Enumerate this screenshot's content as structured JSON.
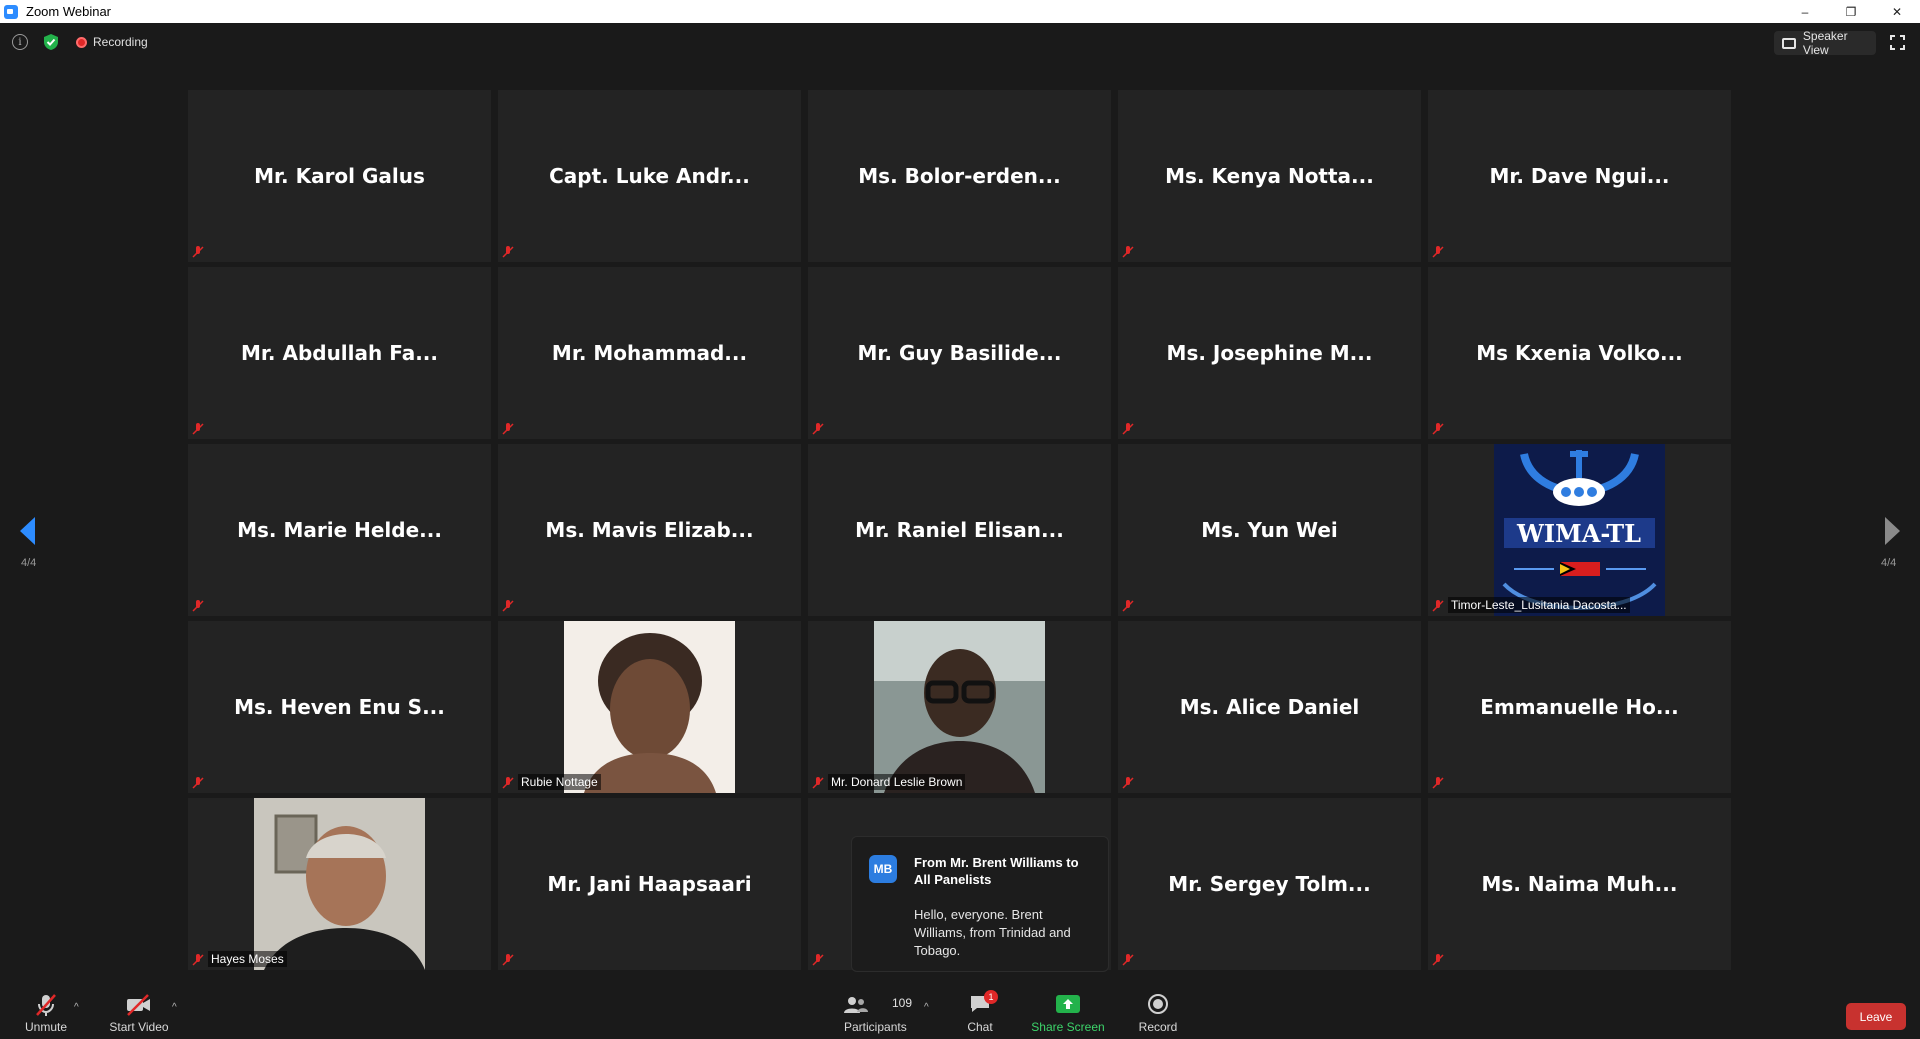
{
  "window": {
    "title": "Zoom Webinar",
    "controls": [
      "–",
      "❐",
      "✕"
    ]
  },
  "topbar": {
    "recording_label": "Recording",
    "speaker_view_label": "Speaker View"
  },
  "grid": {
    "page_indicator": "4/4",
    "tiles": [
      {
        "name": "Mr. Karol Galus"
      },
      {
        "name": "Capt. Luke Andr..."
      },
      {
        "name": "Ms.  Bolor-erden..."
      },
      {
        "name": "Ms. Kenya Notta..."
      },
      {
        "name": "Mr. Dave Ngui..."
      },
      {
        "name": "Mr. Abdullah Fa..."
      },
      {
        "name": "Mr.  Mohammad..."
      },
      {
        "name": "Mr. Guy Basilide..."
      },
      {
        "name": "Ms. Josephine M..."
      },
      {
        "name": "Ms Kxenia Volko..."
      },
      {
        "name": "Ms. Marie Helde..."
      },
      {
        "name": "Ms. Mavis Elizab..."
      },
      {
        "name": "Mr. Raniel Elisan..."
      },
      {
        "name": "Ms. Yun Wei"
      },
      {
        "label": "Timor-Leste_Lusitania Dacosta...",
        "image": "wima-tl-logo",
        "logo_text": "WIMA-TL"
      },
      {
        "name": "Ms. Heven Enu S..."
      },
      {
        "label": "Rubie Nottage",
        "image": "person-photo"
      },
      {
        "label": "Mr. Donard Leslie Brown",
        "image": "person-photo"
      },
      {
        "name": "Ms. Alice Daniel"
      },
      {
        "name": "Emmanuelle  Ho..."
      },
      {
        "label": "Hayes Moses",
        "image": "person-photo"
      },
      {
        "name": "Mr. Jani Haapsaari"
      },
      {
        "name": ""
      },
      {
        "name": "Mr. Sergey Tolm..."
      },
      {
        "name": "Ms. Naima Muh..."
      }
    ]
  },
  "chat_toast": {
    "avatar_initials": "MB",
    "from": "From Mr. Brent Williams to All Panelists",
    "message": "Hello, everyone. Brent Williams, from Trinidad and Tobago."
  },
  "toolbar": {
    "unmute": "Unmute",
    "start_video": "Start Video",
    "participants": "Participants",
    "participant_count": "109",
    "chat": "Chat",
    "chat_badge": "1",
    "share_screen": "Share Screen",
    "record": "Record",
    "leave": "Leave"
  },
  "colors": {
    "accent": "#2d8cff",
    "leave": "#c8322f",
    "share": "#3cd46a",
    "mute": "#e02828",
    "tile": "#232323"
  }
}
